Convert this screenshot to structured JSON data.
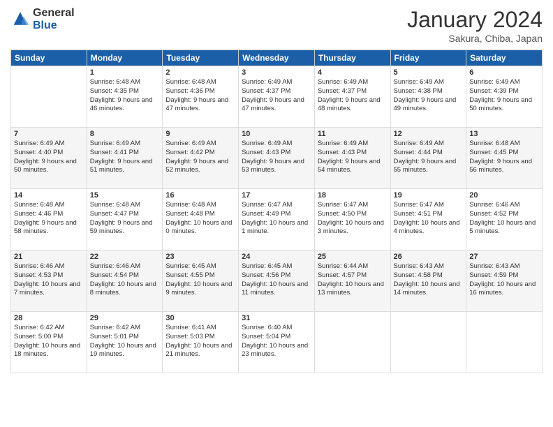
{
  "header": {
    "logo_general": "General",
    "logo_blue": "Blue",
    "month_title": "January 2024",
    "location": "Sakura, Chiba, Japan"
  },
  "weekdays": [
    "Sunday",
    "Monday",
    "Tuesday",
    "Wednesday",
    "Thursday",
    "Friday",
    "Saturday"
  ],
  "weeks": [
    [
      {
        "day": "",
        "sunrise": "",
        "sunset": "",
        "daylight": ""
      },
      {
        "day": "1",
        "sunrise": "Sunrise: 6:48 AM",
        "sunset": "Sunset: 4:35 PM",
        "daylight": "Daylight: 9 hours and 46 minutes."
      },
      {
        "day": "2",
        "sunrise": "Sunrise: 6:48 AM",
        "sunset": "Sunset: 4:36 PM",
        "daylight": "Daylight: 9 hours and 47 minutes."
      },
      {
        "day": "3",
        "sunrise": "Sunrise: 6:49 AM",
        "sunset": "Sunset: 4:37 PM",
        "daylight": "Daylight: 9 hours and 47 minutes."
      },
      {
        "day": "4",
        "sunrise": "Sunrise: 6:49 AM",
        "sunset": "Sunset: 4:37 PM",
        "daylight": "Daylight: 9 hours and 48 minutes."
      },
      {
        "day": "5",
        "sunrise": "Sunrise: 6:49 AM",
        "sunset": "Sunset: 4:38 PM",
        "daylight": "Daylight: 9 hours and 49 minutes."
      },
      {
        "day": "6",
        "sunrise": "Sunrise: 6:49 AM",
        "sunset": "Sunset: 4:39 PM",
        "daylight": "Daylight: 9 hours and 50 minutes."
      }
    ],
    [
      {
        "day": "7",
        "sunrise": "Sunrise: 6:49 AM",
        "sunset": "Sunset: 4:40 PM",
        "daylight": "Daylight: 9 hours and 50 minutes."
      },
      {
        "day": "8",
        "sunrise": "Sunrise: 6:49 AM",
        "sunset": "Sunset: 4:41 PM",
        "daylight": "Daylight: 9 hours and 51 minutes."
      },
      {
        "day": "9",
        "sunrise": "Sunrise: 6:49 AM",
        "sunset": "Sunset: 4:42 PM",
        "daylight": "Daylight: 9 hours and 52 minutes."
      },
      {
        "day": "10",
        "sunrise": "Sunrise: 6:49 AM",
        "sunset": "Sunset: 4:43 PM",
        "daylight": "Daylight: 9 hours and 53 minutes."
      },
      {
        "day": "11",
        "sunrise": "Sunrise: 6:49 AM",
        "sunset": "Sunset: 4:43 PM",
        "daylight": "Daylight: 9 hours and 54 minutes."
      },
      {
        "day": "12",
        "sunrise": "Sunrise: 6:49 AM",
        "sunset": "Sunset: 4:44 PM",
        "daylight": "Daylight: 9 hours and 55 minutes."
      },
      {
        "day": "13",
        "sunrise": "Sunrise: 6:48 AM",
        "sunset": "Sunset: 4:45 PM",
        "daylight": "Daylight: 9 hours and 56 minutes."
      }
    ],
    [
      {
        "day": "14",
        "sunrise": "Sunrise: 6:48 AM",
        "sunset": "Sunset: 4:46 PM",
        "daylight": "Daylight: 9 hours and 58 minutes."
      },
      {
        "day": "15",
        "sunrise": "Sunrise: 6:48 AM",
        "sunset": "Sunset: 4:47 PM",
        "daylight": "Daylight: 9 hours and 59 minutes."
      },
      {
        "day": "16",
        "sunrise": "Sunrise: 6:48 AM",
        "sunset": "Sunset: 4:48 PM",
        "daylight": "Daylight: 10 hours and 0 minutes."
      },
      {
        "day": "17",
        "sunrise": "Sunrise: 6:47 AM",
        "sunset": "Sunset: 4:49 PM",
        "daylight": "Daylight: 10 hours and 1 minute."
      },
      {
        "day": "18",
        "sunrise": "Sunrise: 6:47 AM",
        "sunset": "Sunset: 4:50 PM",
        "daylight": "Daylight: 10 hours and 3 minutes."
      },
      {
        "day": "19",
        "sunrise": "Sunrise: 6:47 AM",
        "sunset": "Sunset: 4:51 PM",
        "daylight": "Daylight: 10 hours and 4 minutes."
      },
      {
        "day": "20",
        "sunrise": "Sunrise: 6:46 AM",
        "sunset": "Sunset: 4:52 PM",
        "daylight": "Daylight: 10 hours and 5 minutes."
      }
    ],
    [
      {
        "day": "21",
        "sunrise": "Sunrise: 6:46 AM",
        "sunset": "Sunset: 4:53 PM",
        "daylight": "Daylight: 10 hours and 7 minutes."
      },
      {
        "day": "22",
        "sunrise": "Sunrise: 6:46 AM",
        "sunset": "Sunset: 4:54 PM",
        "daylight": "Daylight: 10 hours and 8 minutes."
      },
      {
        "day": "23",
        "sunrise": "Sunrise: 6:45 AM",
        "sunset": "Sunset: 4:55 PM",
        "daylight": "Daylight: 10 hours and 9 minutes."
      },
      {
        "day": "24",
        "sunrise": "Sunrise: 6:45 AM",
        "sunset": "Sunset: 4:56 PM",
        "daylight": "Daylight: 10 hours and 11 minutes."
      },
      {
        "day": "25",
        "sunrise": "Sunrise: 6:44 AM",
        "sunset": "Sunset: 4:57 PM",
        "daylight": "Daylight: 10 hours and 13 minutes."
      },
      {
        "day": "26",
        "sunrise": "Sunrise: 6:43 AM",
        "sunset": "Sunset: 4:58 PM",
        "daylight": "Daylight: 10 hours and 14 minutes."
      },
      {
        "day": "27",
        "sunrise": "Sunrise: 6:43 AM",
        "sunset": "Sunset: 4:59 PM",
        "daylight": "Daylight: 10 hours and 16 minutes."
      }
    ],
    [
      {
        "day": "28",
        "sunrise": "Sunrise: 6:42 AM",
        "sunset": "Sunset: 5:00 PM",
        "daylight": "Daylight: 10 hours and 18 minutes."
      },
      {
        "day": "29",
        "sunrise": "Sunrise: 6:42 AM",
        "sunset": "Sunset: 5:01 PM",
        "daylight": "Daylight: 10 hours and 19 minutes."
      },
      {
        "day": "30",
        "sunrise": "Sunrise: 6:41 AM",
        "sunset": "Sunset: 5:03 PM",
        "daylight": "Daylight: 10 hours and 21 minutes."
      },
      {
        "day": "31",
        "sunrise": "Sunrise: 6:40 AM",
        "sunset": "Sunset: 5:04 PM",
        "daylight": "Daylight: 10 hours and 23 minutes."
      },
      {
        "day": "",
        "sunrise": "",
        "sunset": "",
        "daylight": ""
      },
      {
        "day": "",
        "sunrise": "",
        "sunset": "",
        "daylight": ""
      },
      {
        "day": "",
        "sunrise": "",
        "sunset": "",
        "daylight": ""
      }
    ]
  ]
}
